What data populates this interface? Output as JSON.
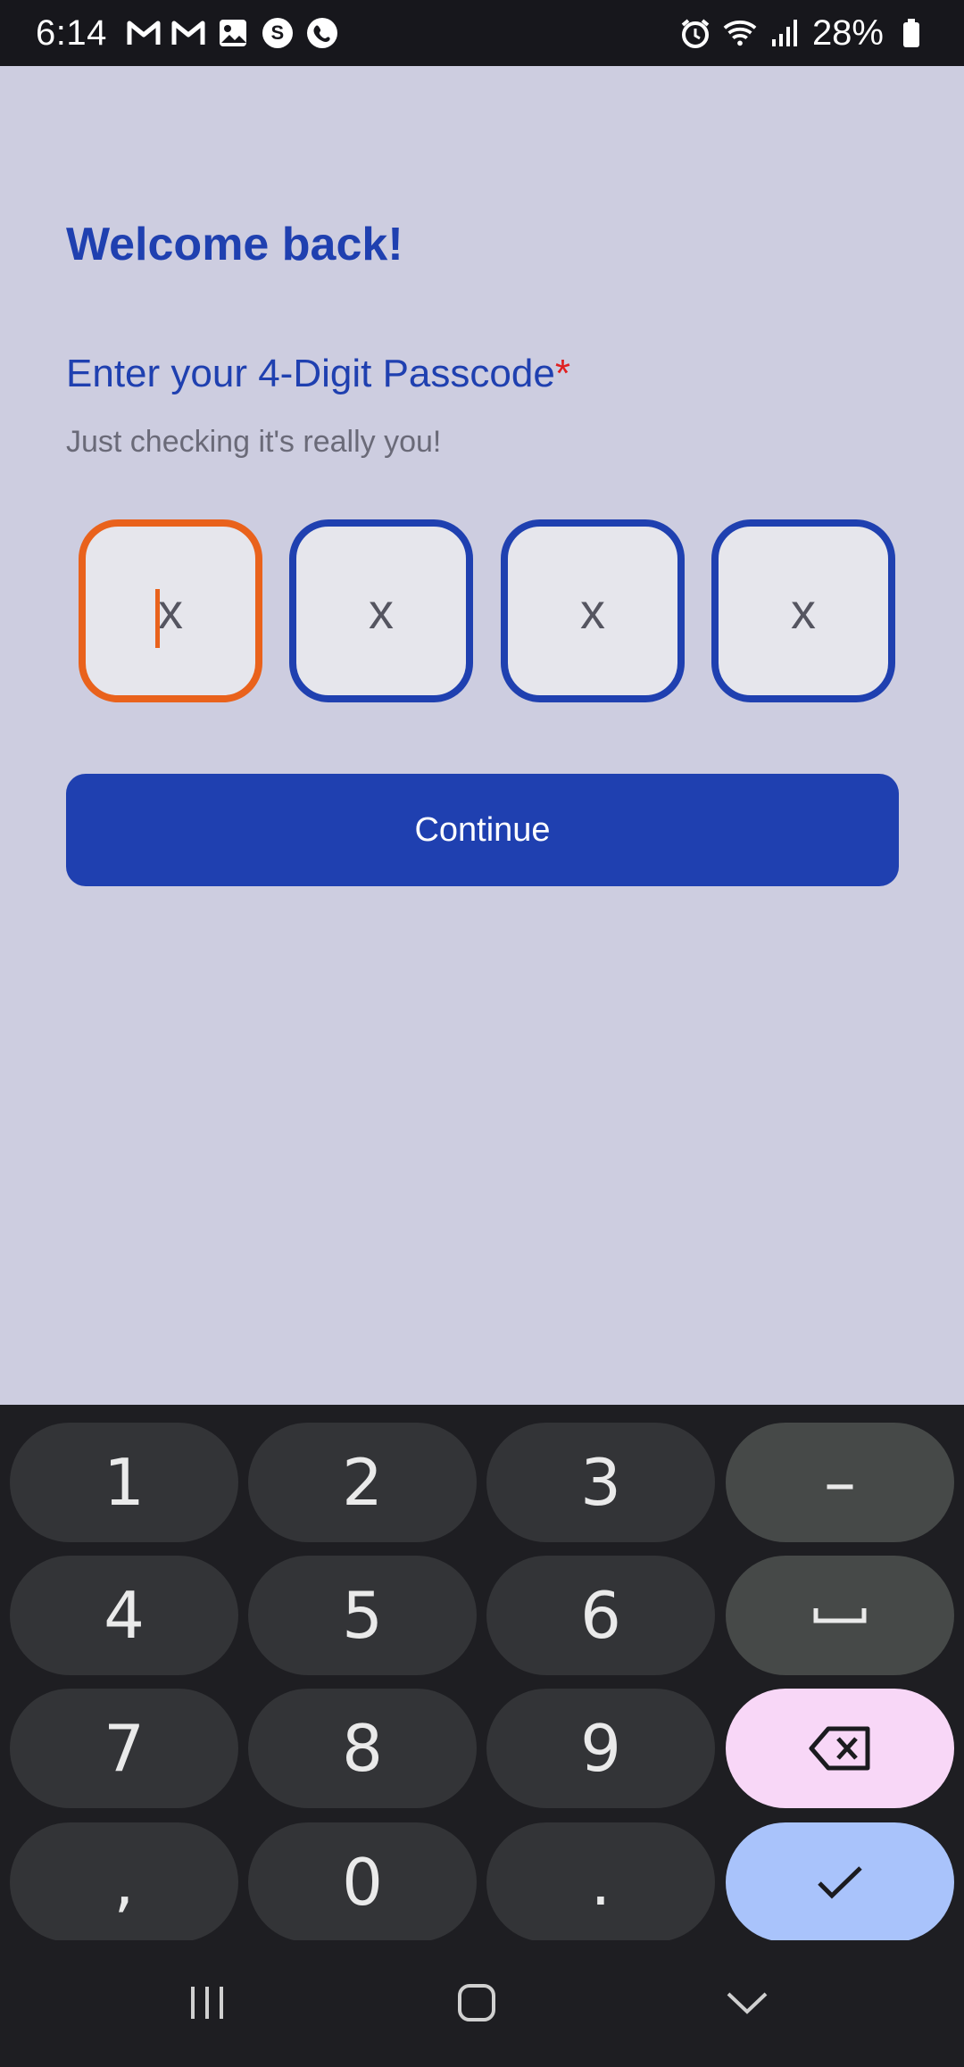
{
  "status_bar": {
    "time": "6:14",
    "battery": "28%",
    "left_icons": [
      "gmail-icon",
      "gmail-icon",
      "gallery-icon",
      "s-app-icon",
      "phone-app-icon"
    ],
    "right_icons": [
      "alarm-icon",
      "wifi-icon",
      "signal-icon",
      "battery-icon"
    ]
  },
  "screen": {
    "title": "Welcome back!",
    "prompt": "Enter your 4-Digit Passcode",
    "required_marker": "*",
    "subtitle": "Just checking it's really you!",
    "otp_placeholders": [
      "x",
      "x",
      "x",
      "x"
    ],
    "continue_label": "Continue"
  },
  "keyboard": {
    "rows": [
      [
        "1",
        "2",
        "3",
        "–"
      ],
      [
        "4",
        "5",
        "6",
        "space"
      ],
      [
        "7",
        "8",
        "9",
        "backspace"
      ],
      [
        ",",
        "0",
        ".",
        "enter"
      ]
    ]
  },
  "navbar": {
    "items": [
      "recent-apps",
      "home",
      "back"
    ]
  },
  "colors": {
    "primary": "#1f40b0",
    "focus": "#e9621c",
    "background": "#cdcde0"
  }
}
